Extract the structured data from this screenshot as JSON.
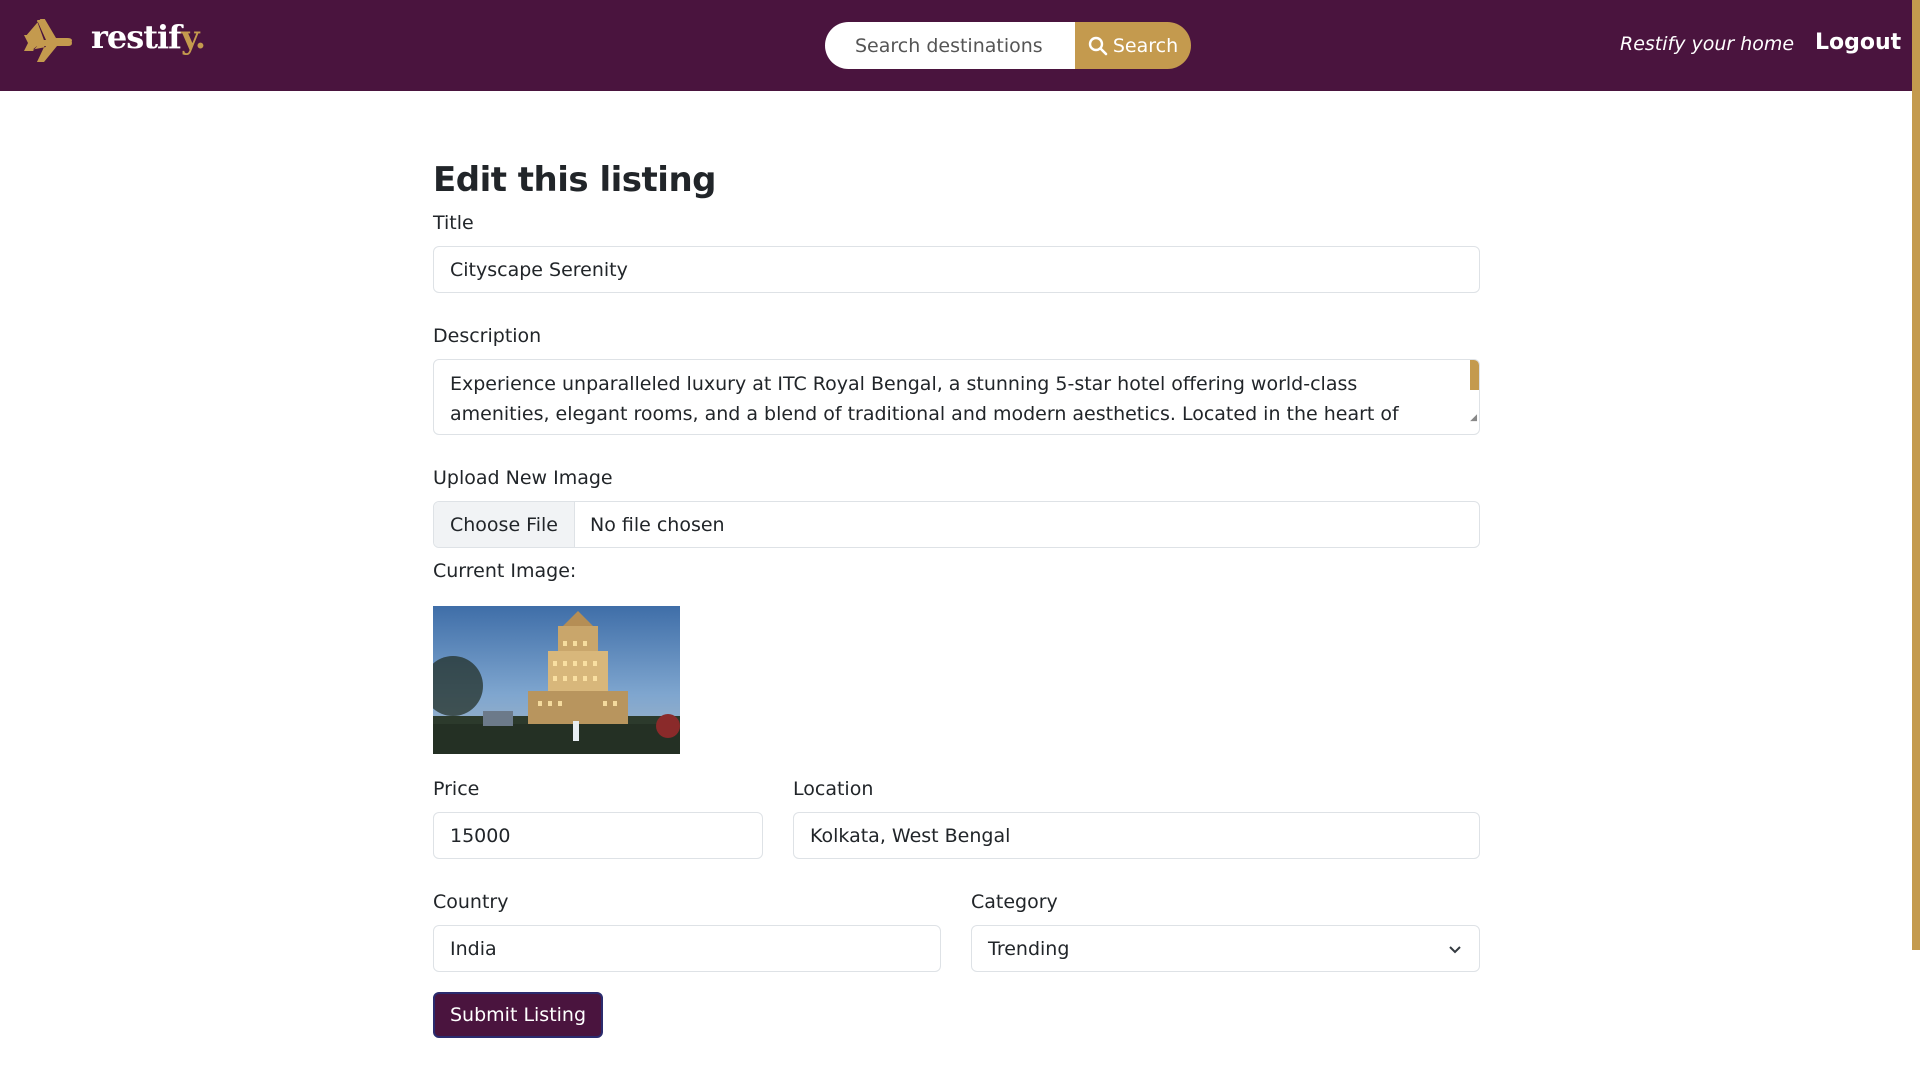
{
  "navbar": {
    "brand": "restif",
    "brand_tail": "y.",
    "search_placeholder": "Search destinations",
    "search_button": "Search",
    "restify_link": "Restify your home",
    "logout_link": "Logout",
    "accent_color": "#c49a4e",
    "bg_color": "#4a143e"
  },
  "form": {
    "heading": "Edit this listing",
    "title_label": "Title",
    "title_value": "Cityscape Serenity",
    "description_label": "Description",
    "description_value": "Experience unparalleled luxury at ITC Royal Bengal, a stunning 5-star hotel offering world-class amenities, elegant rooms, and a blend of traditional and modern aesthetics. Located in the heart of Kolkata, the hotel boasts exquisite dining options, a rejuvenating spa, and breathtaking views of the city.",
    "upload_label": "Upload New Image",
    "file_button": "Choose File",
    "file_status": "No file chosen",
    "current_image_label": "Current Image:",
    "price_label": "Price",
    "price_value": "15000",
    "location_label": "Location",
    "location_value": "Kolkata, West Bengal",
    "country_label": "Country",
    "country_value": "India",
    "category_label": "Category",
    "category_value": "Trending",
    "submit_label": "Submit Listing"
  }
}
